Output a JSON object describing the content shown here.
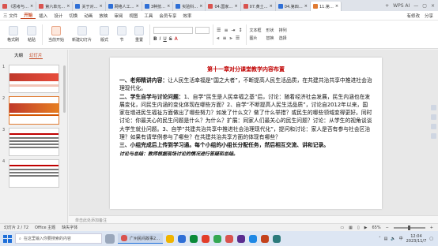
{
  "tabs": [
    {
      "label": "《思考与…",
      "color": "#d9534f"
    },
    {
      "label": "第六单元…",
      "color": "#d9534f"
    },
    {
      "label": "关于对…",
      "color": "#2f6fd6"
    },
    {
      "label": "网络人工…",
      "color": "#2f6fd6"
    },
    {
      "label": "3种技…",
      "color": "#2f6fd6"
    },
    {
      "label": "实验科…",
      "color": "#2f6fd6"
    },
    {
      "label": "04.国家…",
      "color": "#d9534f"
    },
    {
      "label": "07.黄土…",
      "color": "#d9534f"
    },
    {
      "label": "04.第四…",
      "color": "#2f6fd6"
    },
    {
      "label": "11.第…",
      "color": "#e07b32",
      "active": true
    }
  ],
  "tab_right": {
    "wps_ai": "WPS AI"
  },
  "menu": {
    "items": [
      "三 文件",
      "开始",
      "插入",
      "设计",
      "切换",
      "动画",
      "放映",
      "审阅",
      "视图",
      "工具",
      "会员专享",
      "效率"
    ],
    "active_index": 1,
    "right": [
      "有修改",
      "分享"
    ]
  },
  "ribbon": {
    "groups": [
      "格式刷",
      "粘贴",
      "当前开始",
      "新建幻灯片",
      "版式",
      "节",
      "重置"
    ],
    "font_name": "",
    "font_size": "",
    "right_tools": [
      "文本框",
      "形状",
      "排列",
      "图片",
      "替换",
      "选择"
    ]
  },
  "side": {
    "tabs": [
      "大纲",
      "幻灯片"
    ],
    "active_tab": 1,
    "slides": [
      {
        "num": "1",
        "selected": false
      },
      {
        "num": "2",
        "selected": true
      },
      {
        "num": "3",
        "selected": false
      },
      {
        "num": "4",
        "selected": false
      }
    ]
  },
  "slide": {
    "title": "第十一章对分课堂教学内容布置",
    "p1_head": "一、老师精讲内容：",
    "p1_body": "让人民生活幸福是“国之大者”，不断提高人民生活品质，在共建共治共享中推进社会治理现代化。",
    "p2_head": "二、学生自学与讨论问题：",
    "p2_body": "1、自学“民生是人民幸福之基”后，讨论：随着经济社会发展，民生内涵也在发展变化，问民生内涵的变化体现在哪些方面？2、自学“不断提高人民生活品质”，讨论自2012年以来，国家在增进民生福祉方面做出了哪些努力？如发了什么文？做了什么举措？或民生的哪些领域变得更好。同时讨论：你最关心的民生问题是什么？为什么？扩展：同家人们最关心的民生问题？讨论：从学生的视角谈谈大学生就业问题。3、自学“共建共治共享中推进社会治理现代化”，提问和讨论：家人是否有参与社会区治理？如果有请举例参与了哪些？在共建共治共享方面的体现有哪些？",
    "p3_head": "三、小组完成后上传到学习通。每个小组的小组长分配任务，然后相互交流、讲和记录。",
    "p4": "讨论与总结：教师根据现场讨论的情况进行答疑和总结。"
  },
  "notes_placeholder": "单击此处添加备注",
  "status": {
    "slide_counter": "幻灯片 2 / 72",
    "theme": "Office 主题",
    "missing_font": "缺失字体",
    "zoom": "65%"
  },
  "taskbar": {
    "search_placeholder": "在这里输入你要搜索的内容",
    "ppt_task_label": "广州民间故事2…",
    "time": "12:04",
    "date": "2023/11/7"
  }
}
